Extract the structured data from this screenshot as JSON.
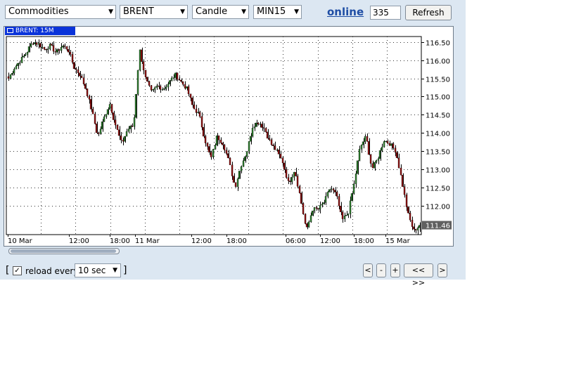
{
  "toolbar": {
    "market_select": "Commodities",
    "symbol_select": "BRENT",
    "chart_type_select": "Candle",
    "timeframe_select": "MIN15",
    "online_link": "online",
    "count_value": "335",
    "refresh_label": "Refresh"
  },
  "chart": {
    "tag_label": "BRENT: 15M",
    "price_tag": "111.46",
    "y_ticks": [
      "116.50",
      "116.00",
      "115.50",
      "115.00",
      "114.50",
      "114.00",
      "113.50",
      "113.00",
      "112.50",
      "112.00"
    ],
    "x_ticks": [
      "10 Mar",
      "12:00",
      "18:00",
      "11 Mar",
      "12:00",
      "18:00",
      "06:00",
      "12:00",
      "18:00",
      "15 Mar"
    ]
  },
  "chart_data": {
    "type": "candlestick",
    "title": "BRENT: 15M",
    "ylim": [
      111.2,
      116.65
    ],
    "current_price": 111.46,
    "x_tick_labels": [
      "10 Mar",
      "12:00",
      "18:00",
      "11 Mar",
      "12:00",
      "18:00",
      "06:00",
      "12:00",
      "18:00",
      "15 Mar"
    ],
    "close_path": [
      115.5,
      115.8,
      116.0,
      116.2,
      116.5,
      116.45,
      116.3,
      116.4,
      116.2,
      116.4,
      116.3,
      115.8,
      115.6,
      115.2,
      114.6,
      113.9,
      114.4,
      114.8,
      114.2,
      113.7,
      114.1,
      114.2,
      116.3,
      115.5,
      115.1,
      115.3,
      115.2,
      115.4,
      115.6,
      115.4,
      115.2,
      114.7,
      114.5,
      113.8,
      113.3,
      113.9,
      113.7,
      113.2,
      112.5,
      113.1,
      113.5,
      114.2,
      114.3,
      114.1,
      113.7,
      113.5,
      113.2,
      112.6,
      113.0,
      112.2,
      111.3,
      111.9,
      111.9,
      112.1,
      112.5,
      112.3,
      111.6,
      111.8,
      112.6,
      113.6,
      113.9,
      113.0,
      113.3,
      113.8,
      113.7,
      113.5,
      112.7,
      111.8,
      111.3,
      111.46
    ],
    "legend": "none",
    "grid": true,
    "colors": {
      "up": "#2d7a2d",
      "down": "#8a1010",
      "wick": "#000000"
    }
  },
  "footer": {
    "reload_label": "reload every",
    "interval_value": "10 sec",
    "reload_checked": "✓",
    "open_bracket": "[",
    "close_bracket": "]",
    "nav_prev": "<",
    "nav_zoom_out": "-",
    "nav_zoom_in": "+",
    "nav_fit": "<< >>",
    "nav_next": ">"
  },
  "colors": {
    "panel_bg": "#dce7f2",
    "accent": "#0a33d9",
    "link": "#1f4ea5"
  }
}
